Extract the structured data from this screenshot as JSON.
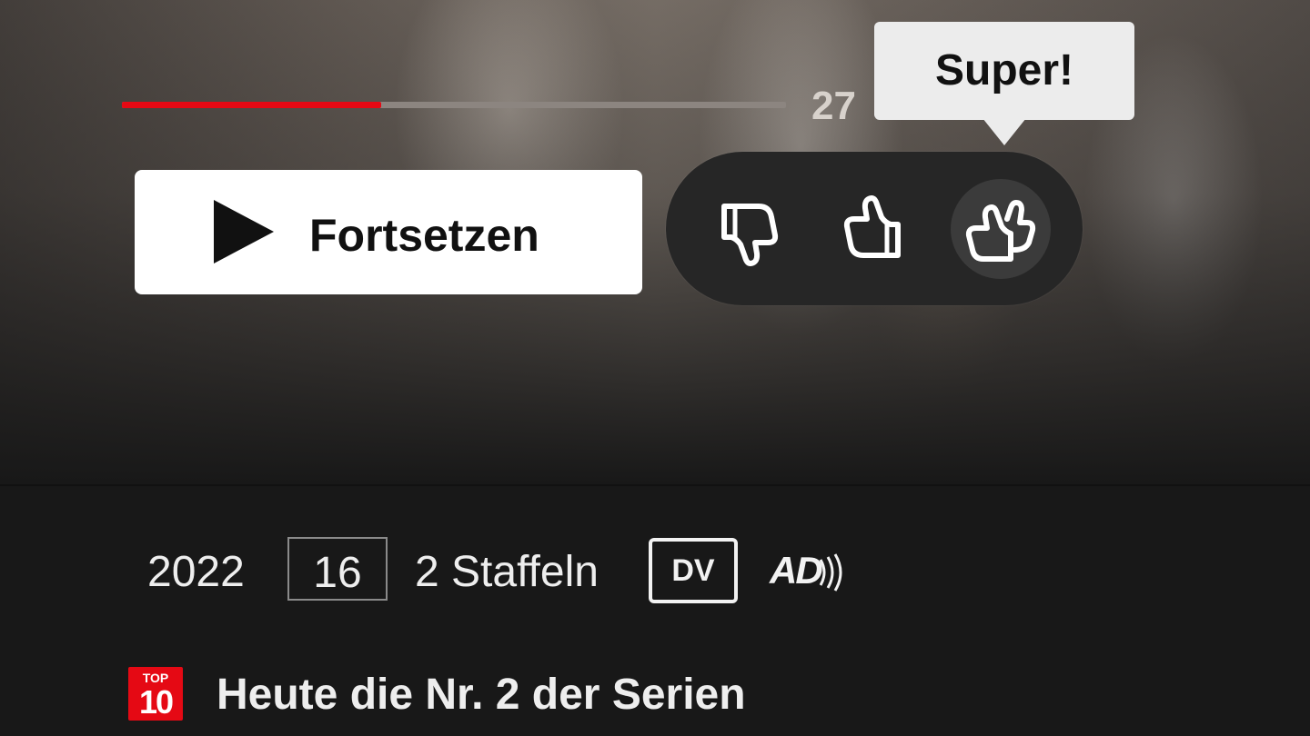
{
  "player": {
    "progress_fraction": 0.39,
    "remaining_text": "27",
    "resume_label": "Fortsetzen"
  },
  "rating": {
    "tooltip": "Super!",
    "options": [
      "thumbs-down",
      "thumbs-up",
      "double-thumbs-up"
    ],
    "selected": "double-thumbs-up"
  },
  "meta": {
    "year": "2022",
    "age_rating": "16",
    "seasons": "2 Staffeln",
    "dv_badge": "DV",
    "ad_badge": "AD"
  },
  "top10": {
    "badge_top": "TOP",
    "badge_num": "10",
    "text": "Heute die Nr. 2 der Serien"
  },
  "colors": {
    "accent": "#e50914",
    "background": "#181818",
    "pill": "#262626"
  }
}
